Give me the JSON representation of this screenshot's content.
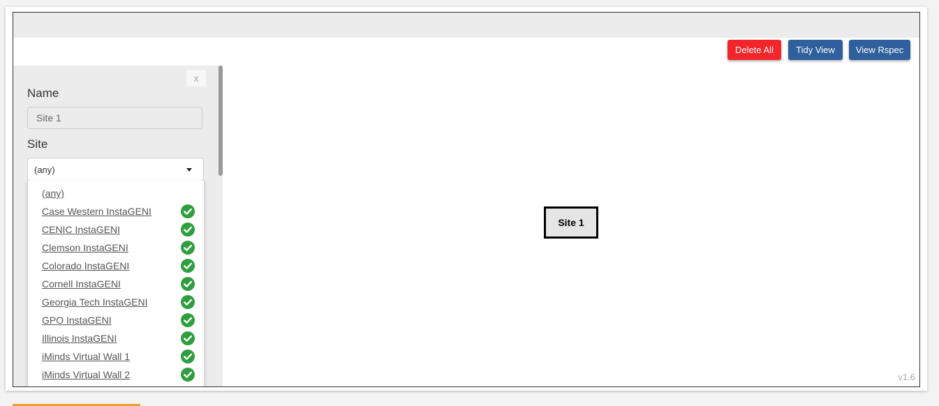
{
  "toolbar": {
    "delete_all_label": "Delete All",
    "tidy_view_label": "Tidy View",
    "view_rspec_label": "View Rspec"
  },
  "side_panel": {
    "close_label": "x",
    "name_label": "Name",
    "name_value": "Site 1",
    "site_label": "Site",
    "site_selected": "(any)",
    "site_options": [
      {
        "label": "(any)",
        "available": false
      },
      {
        "label": "Case Western InstaGENI",
        "available": true
      },
      {
        "label": "CENIC InstaGENI",
        "available": true
      },
      {
        "label": "Clemson InstaGENI",
        "available": true
      },
      {
        "label": "Colorado InstaGENI",
        "available": true
      },
      {
        "label": "Cornell InstaGENI",
        "available": true
      },
      {
        "label": "Georgia Tech InstaGENI",
        "available": true
      },
      {
        "label": "GPO InstaGENI",
        "available": true
      },
      {
        "label": "Illinois InstaGENI",
        "available": true
      },
      {
        "label": "iMinds Virtual Wall 1",
        "available": true
      },
      {
        "label": "iMinds Virtual Wall 2",
        "available": true
      }
    ]
  },
  "canvas": {
    "node_label": "Site 1",
    "version": "v1.6"
  },
  "colors": {
    "delete_button": "#f2262a",
    "primary_button": "#2f5f9c",
    "available_check": "#2e9e3e"
  },
  "icons": {
    "close": "close-icon",
    "dropdown": "caret-down-icon",
    "available": "check-circle-icon"
  }
}
